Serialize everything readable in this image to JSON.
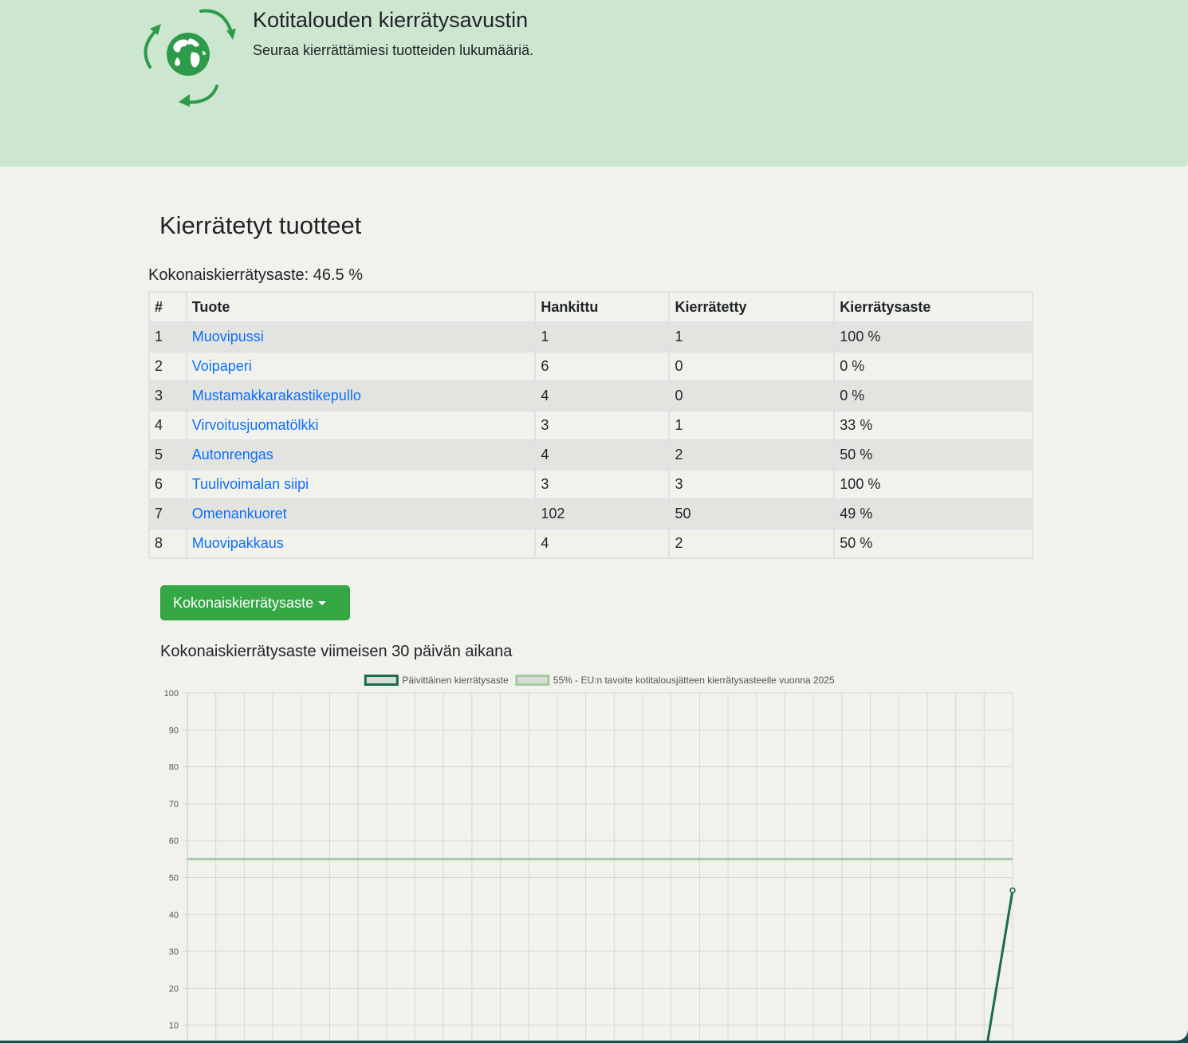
{
  "app": {
    "title": "Kotitalouden kierrätysavustin",
    "subtitle": "Seuraa kierrättämiesi tuotteiden lukumääriä."
  },
  "section": {
    "title": "Kierrätetyt tuotteet"
  },
  "overall": {
    "label": "Kokonaiskierrätysaste: 46.5 %"
  },
  "table": {
    "headers": [
      "#",
      "Tuote",
      "Hankittu",
      "Kierrätetty",
      "Kierrätysaste"
    ],
    "rows": [
      {
        "num": "1",
        "name": "Muovipussi",
        "acquired": "1",
        "recycled": "1",
        "rate": "100 %"
      },
      {
        "num": "2",
        "name": "Voipaperi",
        "acquired": "6",
        "recycled": "0",
        "rate": "0 %"
      },
      {
        "num": "3",
        "name": "Mustamakkarakastikepullo",
        "acquired": "4",
        "recycled": "0",
        "rate": "0 %"
      },
      {
        "num": "4",
        "name": "Virvoitusjuomatölkki",
        "acquired": "3",
        "recycled": "1",
        "rate": "33 %"
      },
      {
        "num": "5",
        "name": "Autonrengas",
        "acquired": "4",
        "recycled": "2",
        "rate": "50 %"
      },
      {
        "num": "6",
        "name": "Tuulivoimalan siipi",
        "acquired": "3",
        "recycled": "3",
        "rate": "100 %"
      },
      {
        "num": "7",
        "name": "Omenankuoret",
        "acquired": "102",
        "recycled": "50",
        "rate": "49 %"
      },
      {
        "num": "8",
        "name": "Muovipakkaus",
        "acquired": "4",
        "recycled": "2",
        "rate": "50 %"
      }
    ]
  },
  "dropdown": {
    "label": "Kokonaiskierrätysaste"
  },
  "chart_heading": "Kokonaiskierrätysaste viimeisen 30 päivän aikana",
  "colors": {
    "header_bg": "#cce6cf",
    "page_bg": "#f1f2ec",
    "primary_green": "#35a745",
    "daily_line": "#1a6b4a",
    "target_line": "#a8c9a8",
    "link": "#0d6efd"
  },
  "icons": {
    "logo": "recycling-globe-icon",
    "dropdown": "caret-down-icon"
  },
  "chart_data": {
    "type": "line",
    "title": "Kokonaiskierrätysaste viimeisen 30 päivän aikana",
    "ylim": [
      0,
      100
    ],
    "y_ticks": [
      10,
      20,
      30,
      40,
      50,
      60,
      70,
      80,
      90,
      100
    ],
    "x_count": 30,
    "grid": true,
    "legend_position": "top",
    "series": [
      {
        "name": "Päivittäinen kierrätysaste",
        "color": "#1a6b4a",
        "values": [
          0,
          0,
          0,
          0,
          0,
          0,
          0,
          0,
          0,
          0,
          0,
          0,
          0,
          0,
          0,
          0,
          0,
          0,
          0,
          0,
          0,
          0,
          0,
          0,
          0,
          0,
          0,
          0,
          0,
          46.5
        ]
      },
      {
        "name": "55% - EU:n tavoite kotitalousjätteen kierrätysasteelle vuonna 2025",
        "color": "#a8c9a8",
        "values": [
          55,
          55,
          55,
          55,
          55,
          55,
          55,
          55,
          55,
          55,
          55,
          55,
          55,
          55,
          55,
          55,
          55,
          55,
          55,
          55,
          55,
          55,
          55,
          55,
          55,
          55,
          55,
          55,
          55,
          55
        ]
      }
    ]
  }
}
